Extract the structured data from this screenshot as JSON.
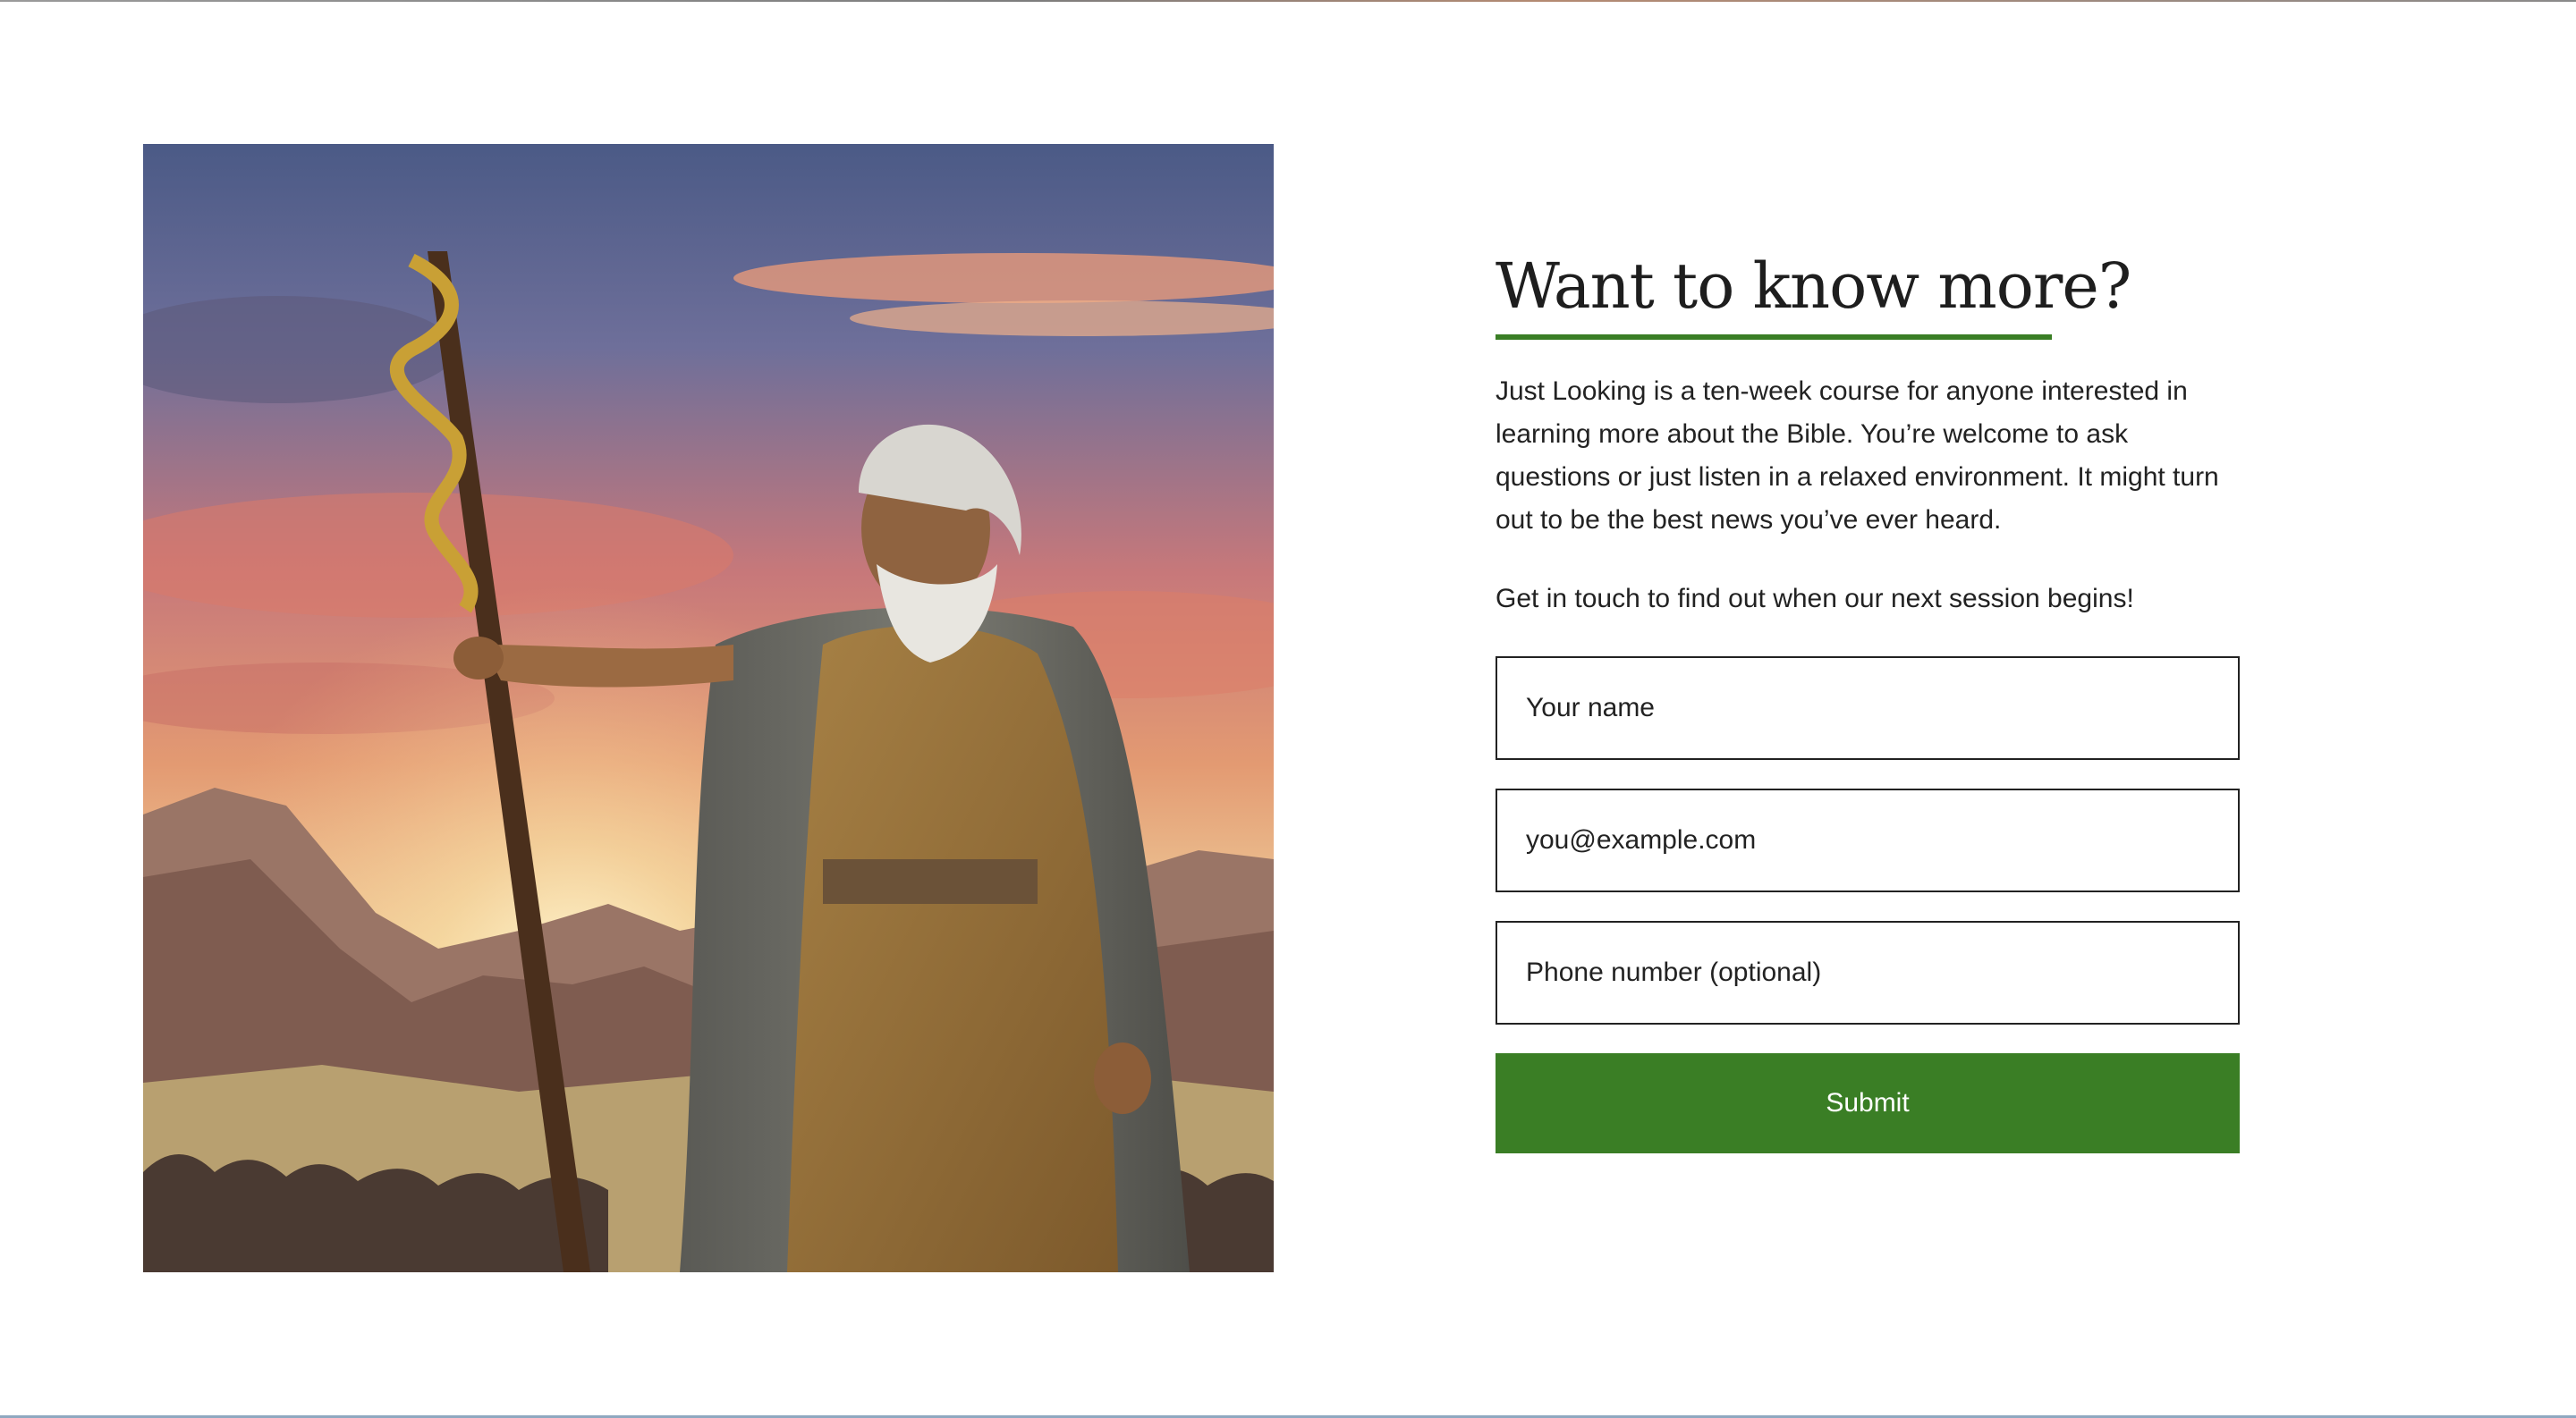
{
  "section": {
    "title": "Want to know more?",
    "intro": "Just Looking is a ten-week course for anyone interested in learning more about the Bible. You’re welcome to ask questions or just listen in a relaxed environment. It might turn out to be the best news you’ve ever heard.",
    "cta": "Get in touch to find out when our next session begins!"
  },
  "form": {
    "name_placeholder": "Your name",
    "email_placeholder": "you@example.com",
    "phone_placeholder": "Phone number (optional)",
    "submit_label": "Submit"
  },
  "colors": {
    "accent": "#3a7e25",
    "text": "#222222",
    "border": "#222222"
  }
}
